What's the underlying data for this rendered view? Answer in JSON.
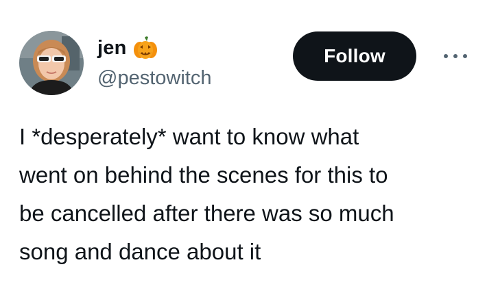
{
  "author": {
    "display_name": "jen",
    "name_emoji": "pumpkin-icon",
    "handle": "@pestowitch",
    "avatar": "avatar"
  },
  "actions": {
    "follow_label": "Follow",
    "more_icon": "more-icon"
  },
  "tweet": {
    "text": "I *desperately* want to know what\nwent on behind the scenes for this to\nbe cancelled after there was so much\nsong and dance about it"
  },
  "colors": {
    "text": "#0f1419",
    "secondary": "#536471",
    "follow_bg": "#0f1419",
    "follow_text": "#ffffff",
    "pumpkin": "#f4900c"
  }
}
